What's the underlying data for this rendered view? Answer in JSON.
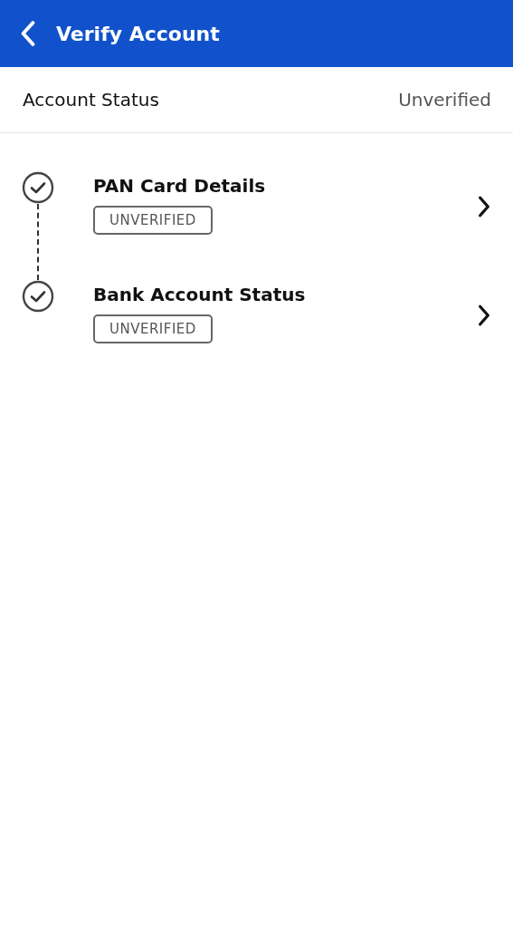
{
  "header": {
    "title": "Verify Account"
  },
  "account_status": {
    "label": "Account Status",
    "value": "Unverified"
  },
  "steps": [
    {
      "title": "PAN Card Details",
      "badge": "UNVERIFIED"
    },
    {
      "title": "Bank Account Status",
      "badge": "UNVERIFIED"
    }
  ]
}
